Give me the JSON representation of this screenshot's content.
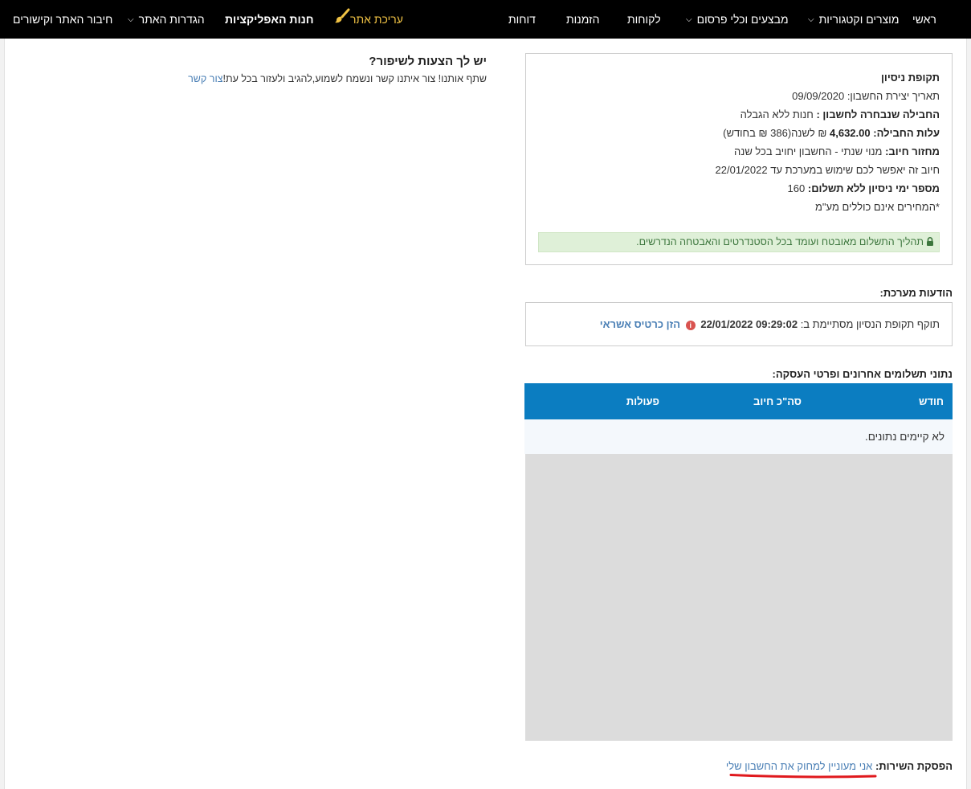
{
  "nav": {
    "home": "ראשי",
    "products": "מוצרים וקטגוריות",
    "promotions": "מבצעים וכלי פרסום",
    "customers": "לקוחות",
    "orders": "הזמנות",
    "reports": "דוחות",
    "edit_site": "עריכת אתר",
    "app_store": "חנות האפליקציות",
    "site_settings": "הגדרות האתר",
    "connect": "חיבור האתר וקישורים"
  },
  "suggest": {
    "title": "יש לך הצעות לשיפור?",
    "text": "שתף אותנו! צור איתנו קשר ונשמח לשמוע,להגיב ולעזור בכל עת!",
    "link": "צור קשר"
  },
  "trial": {
    "heading": "תקופת ניסיון",
    "created_label": "תאריך יצירת החשבון:",
    "created_value": "09/09/2020",
    "package_label": "החבילה שנבחרה לחשבון :",
    "package_value": "חנות ללא הגבלה",
    "cost_label": "עלות החבילה:",
    "cost_value": "4,632.00",
    "cost_suffix": "₪ לשנה(386 ₪ בחודש)",
    "cycle_label": "מחזור חיוב:",
    "cycle_value": "מנוי שנתי - החשבון יחויב בכל שנה",
    "usage_note": "חיוב זה יאפשר לכם שימוש במערכת עד 22/01/2022",
    "trial_days_label": "מספר ימי ניסיון ללא תשלום:",
    "trial_days_value": "160",
    "vat_note": "*המחירים אינם כוללים מע\"מ",
    "secure_note": "תהליך התשלום מאובטח ועומד בכל הסטנדרטים והאבטחה הנדרשים."
  },
  "system_messages": {
    "title": "הודעות מערכת:",
    "text": "תוקף תקופת הנסיון מסתיימת ב:",
    "expiry": "22/01/2022 09:29:02",
    "card_link": "הזן כרטיס אשראי"
  },
  "payments": {
    "title": "נתוני תשלומים אחרונים ופרטי העסקה:",
    "columns": [
      "חודש",
      "סה\"כ חיוב",
      "פעולות"
    ],
    "empty": "לא קיימים נתונים."
  },
  "cancel": {
    "label": "הפסקת השירות:",
    "link": "אני מעוניין למחוק את החשבון שלי"
  },
  "colors": {
    "nav_bg": "#000000",
    "table_header": "#0b7dc1",
    "link": "#4a7fb5",
    "highlight": "#f0c244",
    "success_bg": "#dff0d8",
    "mark_red": "#e0191d"
  }
}
